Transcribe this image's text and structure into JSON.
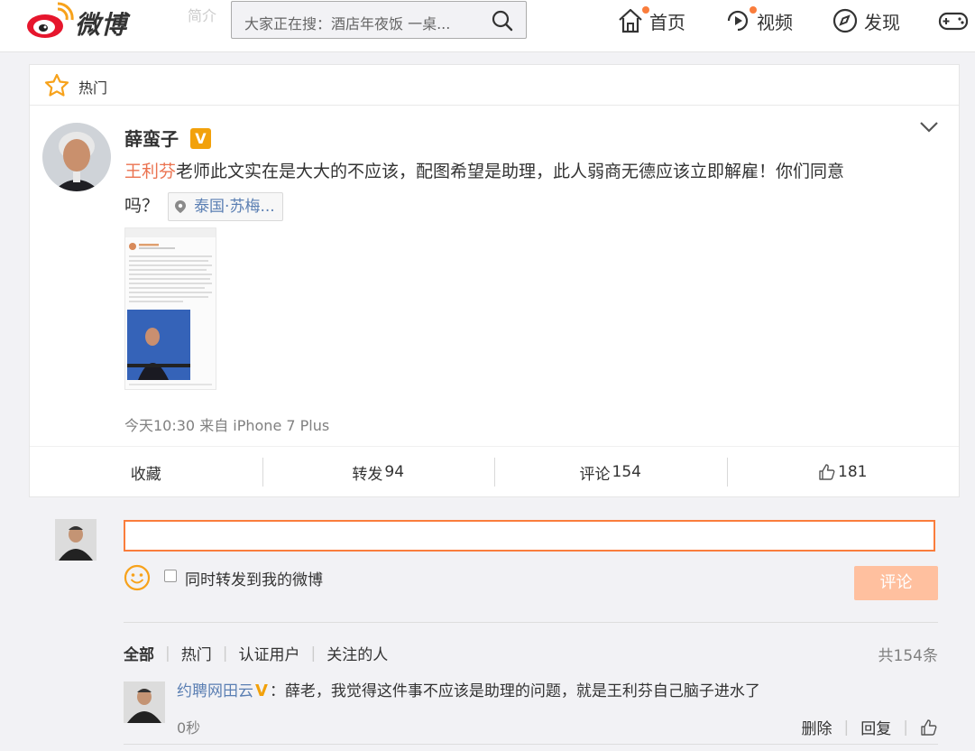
{
  "nav": {
    "logo_text": "微博",
    "ghost_text": "简介",
    "search_placeholder": "大家正在搜：酒店年夜饭 一桌...",
    "items": [
      {
        "label": "首页",
        "icon": "home-icon",
        "has_dot": true
      },
      {
        "label": "视频",
        "icon": "video-icon",
        "has_dot": true
      },
      {
        "label": "发现",
        "icon": "compass-icon",
        "has_dot": false
      }
    ],
    "accent_color": "#fa7d3c"
  },
  "card": {
    "section_label": "热门",
    "user_name": "薛蛮子",
    "verified_badge": "V",
    "mention": "王利芬",
    "text_line1": "老师此文实在是大大的不应该，配图希望是助理，此人弱商无德应该立即解雇！你们同意",
    "text_line2": "吗？",
    "location": "泰国·苏梅...",
    "timestamp": "今天10:30 来自 iPhone 7 Plus",
    "actions": {
      "favorite": "收藏",
      "repost_label": "转发",
      "repost_count": "94",
      "comment_label": "评论",
      "comment_count": "154",
      "like_count": "181"
    }
  },
  "compose": {
    "input_value": "",
    "also_repost_label": "同时转发到我的微博",
    "submit_label": "评论"
  },
  "comments": {
    "filters": [
      "全部",
      "热门",
      "认证用户",
      "关注的人"
    ],
    "total": "共154条",
    "items": [
      {
        "user": "约聘网田云",
        "verified": "V",
        "text": "：薛老，我觉得这件事不应该是助理的问题，就是王利芬自己脑子进水了",
        "time": "0秒",
        "delete_label": "删除",
        "reply_label": "回复"
      }
    ]
  }
}
